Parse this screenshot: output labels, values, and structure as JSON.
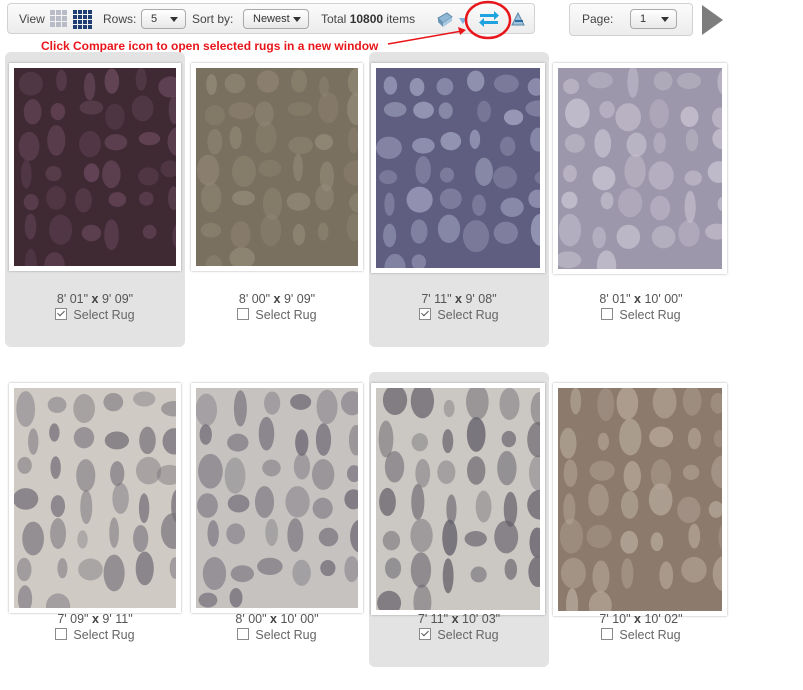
{
  "toolbar": {
    "view_label": "View",
    "rows_label": "Rows:",
    "rows_value": "5",
    "sort_label": "Sort by:",
    "sort_value": "Newest",
    "total_label": "Total",
    "total_count": "10800",
    "items_label": "items"
  },
  "pager": {
    "page_label": "Page:",
    "page_value": "1"
  },
  "annotation": {
    "text": "Click Compare icon to open selected rugs in a new window"
  },
  "colors": {
    "accent_red": "#e8161b",
    "selected_card_bg": "#e3e3e3",
    "compare_icon": "#1fa3e0"
  },
  "select_label": "Select Rug",
  "rugs": [
    {
      "w": "8' 01\"",
      "h": "9' 09\"",
      "checked": true,
      "base": "#3f2a33",
      "pattern": "#6b4a5e"
    },
    {
      "w": "8' 00\"",
      "h": "9' 09\"",
      "checked": false,
      "base": "#7a705f",
      "pattern": "#948a78"
    },
    {
      "w": "7' 11\"",
      "h": "9' 08\"",
      "checked": true,
      "base": "#5f5d80",
      "pattern": "#a6a7c4"
    },
    {
      "w": "8' 01\"",
      "h": "10' 00\"",
      "checked": false,
      "base": "#9d97ab",
      "pattern": "#c9c4d2"
    },
    {
      "w": "7' 09\"",
      "h": "9' 11\"",
      "checked": false,
      "base": "#cfcac4",
      "pattern": "#77737b"
    },
    {
      "w": "8' 00\"",
      "h": "10' 00\"",
      "checked": false,
      "base": "#c6c2c0",
      "pattern": "#6d6873"
    },
    {
      "w": "7' 11\"",
      "h": "10' 03\"",
      "checked": true,
      "base": "#cbc7c2",
      "pattern": "#65616b"
    },
    {
      "w": "7' 10\"",
      "h": "10' 02\"",
      "checked": false,
      "base": "#8c7a6c",
      "pattern": "#b5a89a"
    }
  ]
}
